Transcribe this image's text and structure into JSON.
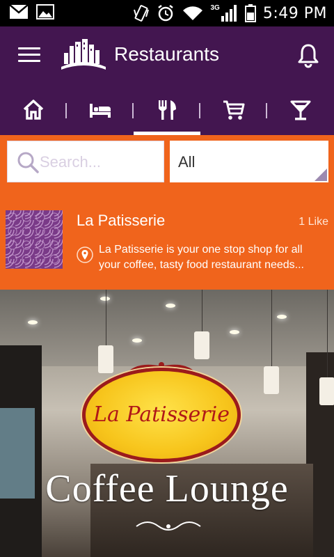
{
  "status_bar": {
    "time": "5:49 PM",
    "network": "3G",
    "icons": [
      "gmail-icon",
      "gallery-icon",
      "vibrate-icon",
      "alarm-icon",
      "wifi-icon",
      "signal-icon",
      "battery-icon"
    ]
  },
  "app_bar": {
    "title": "Restaurants",
    "menu_icon": "hamburger-icon",
    "logo_icon": "city-skyline-logo",
    "bell_icon": "bell-icon"
  },
  "tabs": [
    {
      "name": "home",
      "icon": "home-icon",
      "active": false
    },
    {
      "name": "hotels",
      "icon": "bed-icon",
      "active": false
    },
    {
      "name": "restaurants",
      "icon": "fork-knife-icon",
      "active": true
    },
    {
      "name": "shopping",
      "icon": "cart-icon",
      "active": false
    },
    {
      "name": "bars",
      "icon": "cocktail-icon",
      "active": false
    }
  ],
  "search": {
    "placeholder": "Search...",
    "value": ""
  },
  "filter": {
    "selected": "All"
  },
  "listing": {
    "title": "La Patisserie",
    "likes": "1 Like",
    "description_line1": "La Patisserie is your one stop shop for all",
    "description_line2": "your coffee, tasty food restaurant needs..."
  },
  "hero": {
    "sign_name": "La Patisserie",
    "sign_subtitle": "Coffee Lounge"
  },
  "colors": {
    "primary": "#431650",
    "accent": "#f0641c",
    "active_underline": "#ffffff"
  }
}
